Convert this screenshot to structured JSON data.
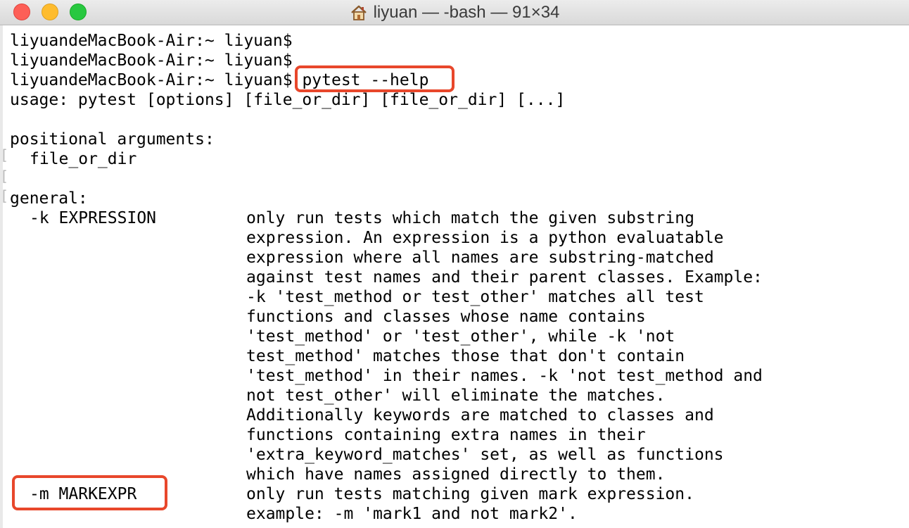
{
  "window": {
    "title": "liyuan — -bash — 91×34",
    "title_icon": "home-icon",
    "traffic_lights": {
      "close": "#fd5f57",
      "minimize": "#febc2e",
      "maximize": "#28c840"
    }
  },
  "terminal": {
    "prompt": "liyuandeMacBook-Air:~ liyuan$",
    "command": "pytest --help",
    "usage": "usage: pytest [options] [file_or_dir] [file_or_dir] [...]",
    "positional_heading": "positional arguments:",
    "positional_arg": "file_or_dir",
    "general_heading": "general:",
    "options": [
      {
        "flag": "-k EXPRESSION",
        "description": [
          "only run tests which match the given substring",
          "expression. An expression is a python evaluatable",
          "expression where all names are substring-matched",
          "against test names and their parent classes. Example:",
          "-k 'test_method or test_other' matches all test",
          "functions and classes whose name contains",
          "'test_method' or 'test_other', while -k 'not",
          "test_method' matches those that don't contain",
          "'test_method' in their names. -k 'not test_method and",
          "not test_other' will eliminate the matches.",
          "Additionally keywords are matched to classes and",
          "functions containing extra names in their",
          "'extra_keyword_matches' set, as well as functions",
          "which have names assigned directly to them."
        ]
      },
      {
        "flag": "-m MARKEXPR",
        "description": [
          "only run tests matching given mark expression.",
          "example: -m 'mark1 and not mark2'."
        ]
      }
    ],
    "gutter_mark": "["
  },
  "colors": {
    "highlight": "#e8472b",
    "text": "#000000",
    "background": "#ffffff"
  }
}
